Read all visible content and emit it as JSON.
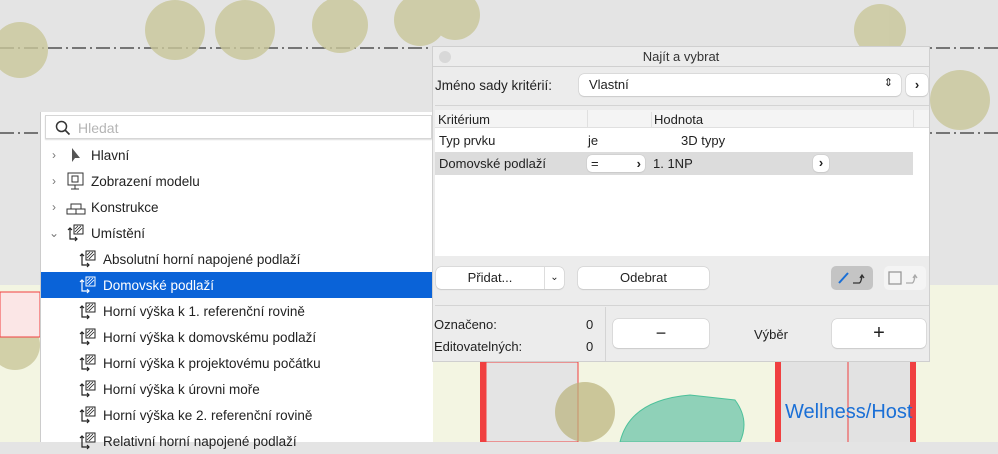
{
  "canvas": {
    "room_label": "Wellness/Host"
  },
  "tree": {
    "search_placeholder": "Hledat",
    "items": [
      {
        "label": "Hlavní",
        "icon": "pointer-icon",
        "expand": "collapsed"
      },
      {
        "label": "Zobrazení modelu",
        "icon": "monitor-icon",
        "expand": "collapsed"
      },
      {
        "label": "Konstrukce",
        "icon": "brick-icon",
        "expand": "collapsed"
      },
      {
        "label": "Umístění",
        "icon": "placement-icon",
        "expand": "expanded"
      },
      {
        "label": "Absolutní horní napojené podlaží",
        "icon": "placement-icon"
      },
      {
        "label": "Domovské podlaží",
        "icon": "placement-icon",
        "selected": true
      },
      {
        "label": "Horní výška k 1. referenční rovině",
        "icon": "placement-icon"
      },
      {
        "label": "Horní výška k domovskému podlaží",
        "icon": "placement-icon"
      },
      {
        "label": "Horní výška k projektovému počátku",
        "icon": "placement-icon"
      },
      {
        "label": "Horní výška k úrovni moře",
        "icon": "placement-icon"
      },
      {
        "label": "Horní výška ke 2. referenční rovině",
        "icon": "placement-icon"
      },
      {
        "label": "Relativní horní napojené podlaží",
        "icon": "placement-icon"
      }
    ]
  },
  "dialog": {
    "title": "Najít a vybrat",
    "set_label": "Jméno sady kritérií:",
    "set_value": "Vlastní",
    "headers": {
      "criterion": "Kritérium",
      "value": "Hodnota"
    },
    "rows": [
      {
        "criterion": "Typ prvku",
        "op": "je",
        "value": "3D typy"
      },
      {
        "criterion": "Domovské podlaží",
        "op": "=",
        "value": "1. 1NP"
      }
    ],
    "add_label": "Přidat...",
    "remove_label": "Odebrat",
    "marked_label": "Označeno:",
    "marked_value": "0",
    "editable_label": "Editovatelných:",
    "editable_value": "0",
    "selection_label": "Výběr",
    "minus": "−",
    "plus": "+"
  },
  "colors": {
    "selection": "#0a63d8",
    "wall": "#f04040",
    "room_text": "#1a6fd6"
  }
}
